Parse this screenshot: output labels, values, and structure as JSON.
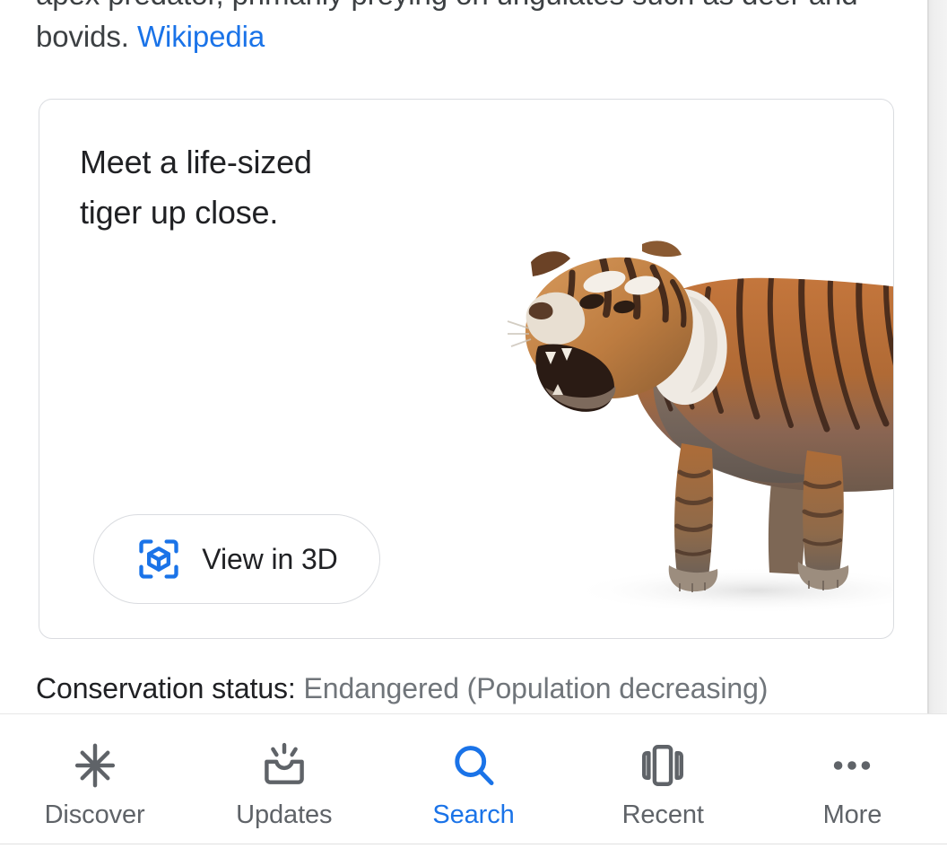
{
  "page": {
    "description_before_link": "apex predator, primarily preying on ungulates such as deer and bovids. ",
    "wikipedia_link": "Wikipedia"
  },
  "ar_card": {
    "title": "Meet a life-sized\ntiger up close.",
    "button_label": "View in 3D",
    "button_icon": "ar-cube-icon",
    "model_image": "tiger-3d-model",
    "accent_color": "#1a73e8",
    "border_color": "#dadce0"
  },
  "conservation": {
    "label": "Conservation status:",
    "value": "Endangered (Population decreasing)",
    "label_color": "#202124",
    "value_color": "#70757a"
  },
  "bottom_nav": {
    "active_color": "#1a73e8",
    "inactive_color": "#5f6368",
    "items": [
      {
        "label": "Discover",
        "icon": "asterisk-icon",
        "active": false
      },
      {
        "label": "Updates",
        "icon": "inbox-notification-icon",
        "active": false
      },
      {
        "label": "Search",
        "icon": "search-icon",
        "active": true
      },
      {
        "label": "Recent",
        "icon": "recent-cards-icon",
        "active": false
      },
      {
        "label": "More",
        "icon": "more-dots-icon",
        "active": false
      }
    ]
  }
}
